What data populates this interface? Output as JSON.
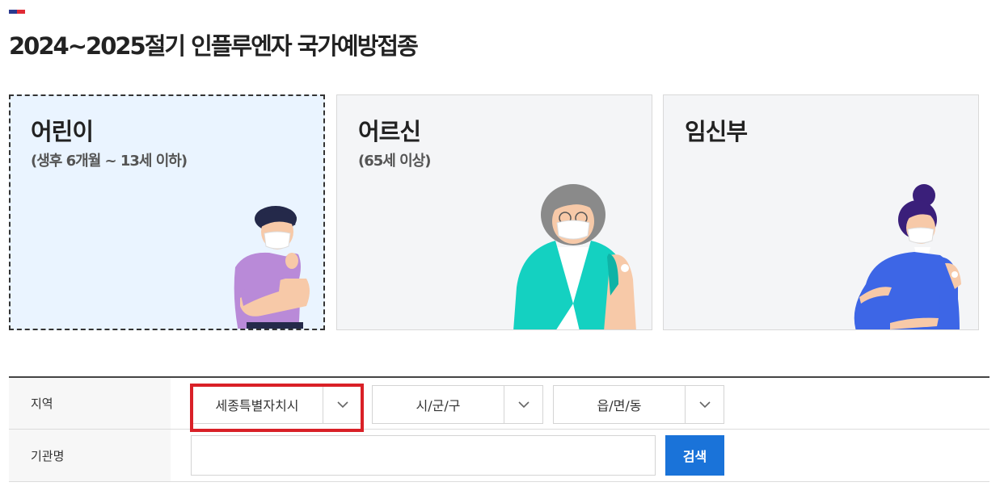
{
  "page": {
    "title": "2024~2025절기 인플루엔자 국가예방접종"
  },
  "cards": [
    {
      "title": "어린이",
      "subtitle": "(생후 6개월 ~ 13세 이하)",
      "selected": true,
      "illustration": "child-vaccination-illustration"
    },
    {
      "title": "어르신",
      "subtitle": "(65세 이상)",
      "selected": false,
      "illustration": "elderly-vaccination-illustration"
    },
    {
      "title": "임신부",
      "subtitle": "",
      "selected": false,
      "illustration": "pregnant-vaccination-illustration"
    }
  ],
  "search": {
    "region_label": "지역",
    "province_value": "세종특별자치시",
    "city_placeholder": "시/군/구",
    "town_placeholder": "읍/면/동",
    "institution_label": "기관명",
    "institution_value": "",
    "search_button": "검색"
  },
  "colors": {
    "accent": "#1a73d9",
    "highlight": "#d92027",
    "selected_card_bg": "#eaf4ff",
    "card_bg": "#f4f5f7"
  }
}
